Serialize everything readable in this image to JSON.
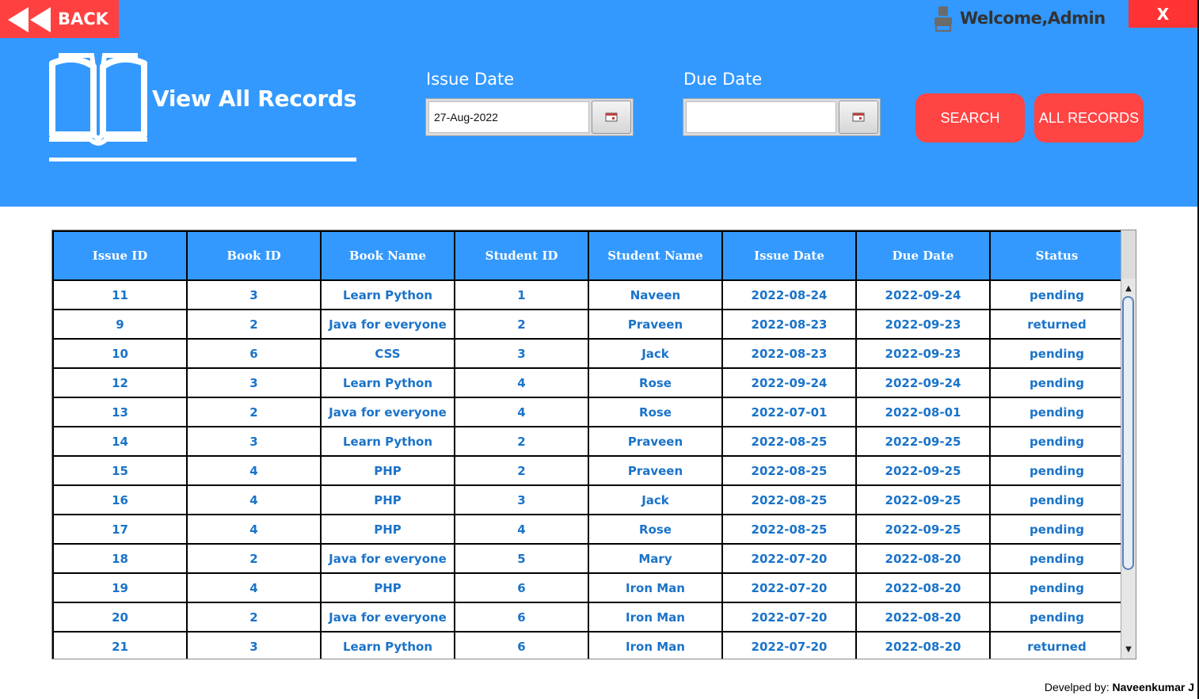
{
  "header": {
    "back_label": "BACK",
    "close_label": "X",
    "welcome": "Welcome,Admin",
    "title": "View All Records",
    "accent_color": "#3399ff",
    "button_color": "#ff4444"
  },
  "filters": {
    "issue_date_label": "Issue Date",
    "issue_date_value": "27-Aug-2022",
    "due_date_label": "Due Date",
    "due_date_value": ""
  },
  "buttons": {
    "search": "SEARCH",
    "all_records": "ALL RECORDS"
  },
  "table": {
    "columns": [
      "Issue ID",
      "Book ID",
      "Book Name",
      "Student ID",
      "Student Name",
      "Issue Date",
      "Due Date",
      "Status"
    ],
    "rows": [
      [
        "11",
        "3",
        "Learn Python",
        "1",
        "Naveen",
        "2022-08-24",
        "2022-09-24",
        "pending"
      ],
      [
        "9",
        "2",
        "Java for everyone",
        "2",
        "Praveen",
        "2022-08-23",
        "2022-09-23",
        "returned"
      ],
      [
        "10",
        "6",
        "CSS",
        "3",
        "Jack",
        "2022-08-23",
        "2022-09-23",
        "pending"
      ],
      [
        "12",
        "3",
        "Learn Python",
        "4",
        "Rose",
        "2022-09-24",
        "2022-09-24",
        "pending"
      ],
      [
        "13",
        "2",
        "Java for everyone",
        "4",
        "Rose",
        "2022-07-01",
        "2022-08-01",
        "pending"
      ],
      [
        "14",
        "3",
        "Learn Python",
        "2",
        "Praveen",
        "2022-08-25",
        "2022-09-25",
        "pending"
      ],
      [
        "15",
        "4",
        "PHP",
        "2",
        "Praveen",
        "2022-08-25",
        "2022-09-25",
        "pending"
      ],
      [
        "16",
        "4",
        "PHP",
        "3",
        "Jack",
        "2022-08-25",
        "2022-09-25",
        "pending"
      ],
      [
        "17",
        "4",
        "PHP",
        "4",
        "Rose",
        "2022-08-25",
        "2022-09-25",
        "pending"
      ],
      [
        "18",
        "2",
        "Java for everyone",
        "5",
        "Mary",
        "2022-07-20",
        "2022-08-20",
        "pending"
      ],
      [
        "19",
        "4",
        "PHP",
        "6",
        "Iron Man",
        "2022-07-20",
        "2022-08-20",
        "pending"
      ],
      [
        "20",
        "2",
        "Java for everyone",
        "6",
        "Iron Man",
        "2022-07-20",
        "2022-08-20",
        "pending"
      ],
      [
        "21",
        "3",
        "Learn Python",
        "6",
        "Iron Man",
        "2022-07-20",
        "2022-08-20",
        "returned"
      ]
    ]
  },
  "footer": {
    "prefix": "Develped by: ",
    "author": "Naveenkumar J"
  }
}
